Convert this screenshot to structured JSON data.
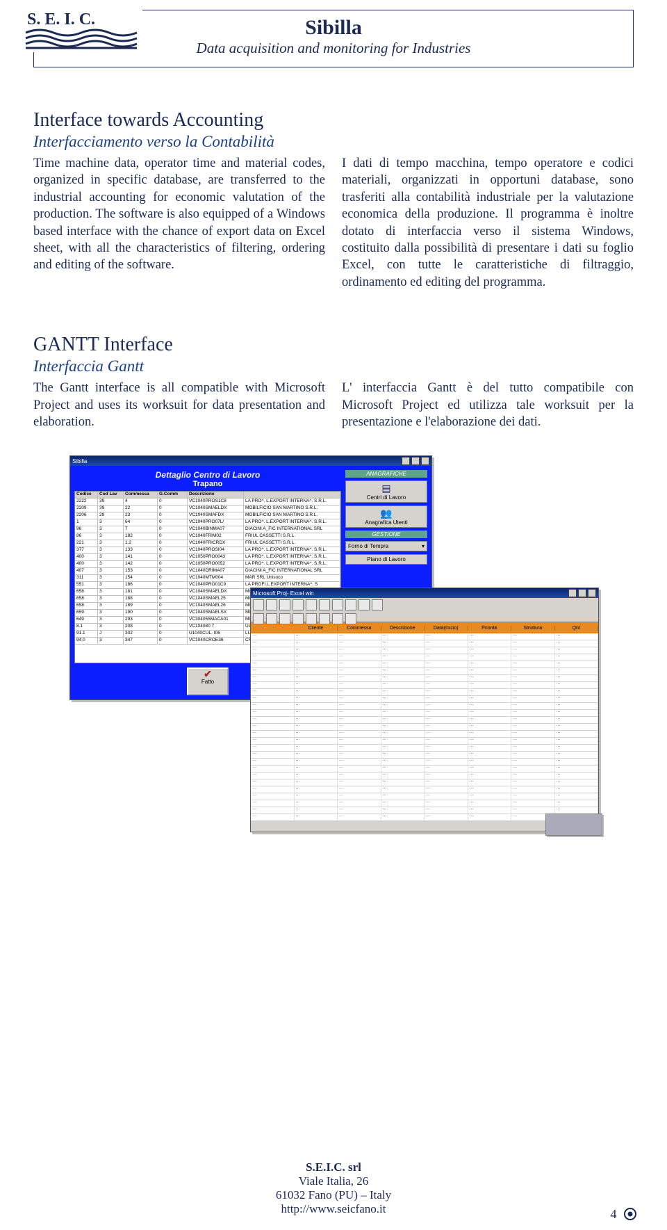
{
  "header": {
    "title": "Sibilla",
    "subtitle": "Data acquisition and monitoring for Industries",
    "logo_text": "S.E.I.C."
  },
  "section1": {
    "title": "Interface towards Accounting",
    "subtitle": "Interfacciamento verso la Contabilità",
    "col_en": "Time machine data, operator time and material codes, organized in specific database, are transferred to the industrial accounting for economic valutation of the production. The software is also equipped of a Windows based interface with the chance of export data on Excel sheet, with all the characteristics of filtering, ordering and editing of the software.",
    "col_it": "I dati di tempo macchina, tempo operatore e codici materiali, organizzati in opportuni database, sono trasferiti alla contabilità industriale per la valutazione economica della produzione. Il programma è inoltre dotato di interfaccia verso il sistema Windows, costituito dalla possibilità di presentare i dati su foglio Excel, con tutte le caratteristiche di filtraggio, ordinamento ed editing del programma."
  },
  "section2": {
    "title": "GANTT Interface",
    "subtitle": "Interfaccia Gantt",
    "col_en": "The Gantt interface is all compatible with Microsoft Project and uses its worksuit for data presentation and elaboration.",
    "col_it": "L' interfaccia Gantt è del tutto compatibile con Microsoft Project ed utilizza tale worksuit per la presentazione e l'elaborazione dei dati."
  },
  "win1": {
    "titlebar": "Sibilla",
    "title": "Dettaglio Centro di Lavoro",
    "subtitle": "Trapano",
    "headers": [
      "Codice",
      "Cod Lav",
      "Commessa",
      "G.Comm",
      "Descrizione",
      ""
    ],
    "rows": [
      [
        "2222",
        "39",
        "4",
        "0",
        "VC1040PROS1C8",
        "LA PRO^. L.EXPORT INTERNA^. S.R.L."
      ],
      [
        "2209",
        "39",
        "22",
        "0",
        "VC1040SMAELDX",
        "MOBILFICIO SAN MARTINO S.R.L."
      ],
      [
        "2206",
        "29",
        "23",
        "0",
        "VC1040SMAFDX",
        "MOBILFICIO SAN MARTINO S.R.L."
      ],
      [
        "1",
        "3",
        "64",
        "0",
        "VC1040PRO07L/",
        "LA PRO^. L.EXPORT INTERNA^. S.R.L."
      ],
      [
        "96",
        "3",
        "7",
        "0",
        "VC1040BINMA07",
        "DIACINI A_FIC INTERNATIONAL SRL"
      ],
      [
        "86",
        "3",
        "182",
        "0",
        "VC1040FRIM02",
        "FRIUL CASSETTI S.R.L."
      ],
      [
        "221",
        "3",
        "1.2",
        "0",
        "VC1040FRICRDX",
        "FRIUL CASSETTI S.R.L."
      ],
      [
        "377",
        "3",
        "133",
        "0",
        "VC1040PROSI04",
        "LA PRO^. L.EXPORT INTERNA^. S.R.L."
      ],
      [
        "400",
        "3",
        "141",
        "0",
        "VC1050PRO0043",
        "LA PRO^. L.EXPORT INTERNA^. S.R.L."
      ],
      [
        "400",
        "3",
        "142",
        "0",
        "VC1050PRO0052",
        "LA PRO^. L.EXPORT INTERNA^. S.R.L."
      ],
      [
        "407",
        "3",
        "153",
        "0",
        "VC1040DRIMA07",
        "DIACINI A_FIC INTERNATIONAL SRL"
      ],
      [
        "311",
        "3",
        "154",
        "0",
        "VC1040MTM004",
        "MAR SRL Unisoco"
      ],
      [
        "551",
        "3",
        "186",
        "0",
        "VC1040PRO01C9",
        "LA PROFI.L.EXPORT INTERNA^. S"
      ],
      [
        "658",
        "3",
        "181",
        "0",
        "VC1040SMAELDX",
        "MOBILFICIO SAN MA"
      ],
      [
        "658",
        "3",
        "188",
        "0",
        "VC1040SMAEL25",
        "MOBILFICIO SAN MA"
      ],
      [
        "658",
        "3",
        "189",
        "0",
        "VC1040SMAEL26",
        "MOBILFICIO SAN MA"
      ],
      [
        "659",
        "3",
        "190",
        "0",
        "VC1040SMAELSX",
        "MOBILFICIO SAN MA"
      ],
      [
        "649",
        "3",
        "293",
        "0",
        "VC304055MACA01",
        "MOBILFICIO SAN MA"
      ],
      [
        "8.1",
        "3",
        "208",
        "0",
        "VC104080 7",
        "ULULUMINA.R.A. RD"
      ],
      [
        "91.1",
        "J",
        "302",
        "0",
        "U1040CUL. t06",
        "LULUMINI S.A. Rt"
      ],
      [
        "94.0",
        "3",
        "347",
        "0",
        "VC1040CROE36",
        "CRISTALERIA ITAL"
      ]
    ],
    "fatto": "Fatto",
    "side": {
      "anagrafiche": "ANAGRAFICHE",
      "centri": "Centri di Lavoro",
      "anautenti": "Anagrafica Utenti",
      "gestione": "GESTIONE",
      "forno": "Forno di Tempra",
      "piano": "Piano di Lavoro"
    }
  },
  "win2": {
    "titlebar": "Microsoft Proj- Excel win",
    "headers": [
      "",
      "Cliente",
      "Commessa",
      "Descrizione",
      "Data(Inizio)",
      "Priorità",
      "Struttura",
      "Qnt"
    ]
  },
  "footer": {
    "company": "S.E.I.C. srl",
    "addr1": "Viale Italia, 26",
    "addr2": "61032 Fano (PU) – Italy",
    "url": "http://www.seicfano.it",
    "page": "4"
  }
}
